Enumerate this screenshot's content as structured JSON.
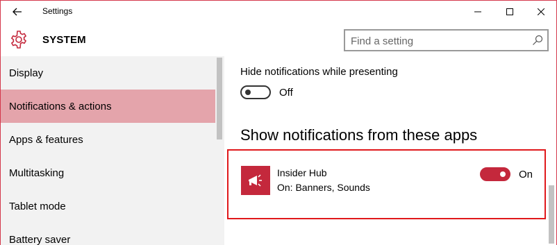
{
  "window": {
    "title": "Settings"
  },
  "header": {
    "section_title": "SYSTEM",
    "search": {
      "placeholder": "Find a setting",
      "value": ""
    }
  },
  "sidebar": {
    "items": [
      {
        "label": "Display",
        "active": false
      },
      {
        "label": "Notifications & actions",
        "active": true
      },
      {
        "label": "Apps & features",
        "active": false
      },
      {
        "label": "Multitasking",
        "active": false
      },
      {
        "label": "Tablet mode",
        "active": false
      },
      {
        "label": "Battery saver",
        "active": false
      }
    ]
  },
  "main": {
    "hide_notifications": {
      "label": "Hide notifications while presenting",
      "state_label": "Off",
      "on": false
    },
    "apps_section_heading": "Show notifications from these apps",
    "apps": [
      {
        "name": "Insider Hub",
        "detail": "On: Banners, Sounds",
        "state_label": "On",
        "on": true,
        "icon": "megaphone-icon"
      }
    ]
  },
  "colors": {
    "accent": "#c4283c",
    "sidebar_active": "#e4a4ab",
    "sidebar_bg": "#f2f2f2",
    "highlight_border": "#e0181b"
  }
}
